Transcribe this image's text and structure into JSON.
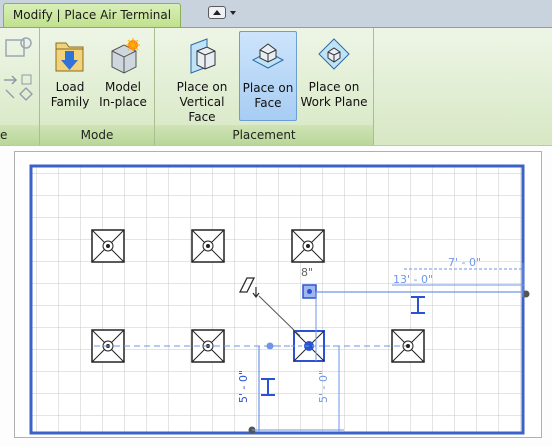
{
  "tab": {
    "label": "Modify | Place Air Terminal"
  },
  "quick_access": {
    "icon": "window-switch-icon"
  },
  "panels": {
    "create": {
      "partial_label": "e"
    },
    "mode": {
      "title": "Mode",
      "load_family": {
        "line1": "Load",
        "line2": "Family"
      },
      "model_inplace": {
        "line1": "Model",
        "line2": "In-place"
      }
    },
    "placement": {
      "title": "Placement",
      "vertical_face": {
        "line1": "Place on",
        "line2": "Vertical Face"
      },
      "face": {
        "line1": "Place on",
        "line2": "Face"
      },
      "work_plane": {
        "line1": "Place on",
        "line2": "Work Plane"
      }
    }
  },
  "canvas": {
    "dimensions": {
      "d1": "7' - 0\"",
      "d2": "13' - 0\"",
      "d3": "8\"",
      "d4": "5' - 0\"",
      "d5": "5' - 0\""
    }
  },
  "colors": {
    "ribbon_accent": "#b9d79a",
    "dimension_blue": "#6f96e6",
    "wall_blue": "#3a62c9"
  }
}
